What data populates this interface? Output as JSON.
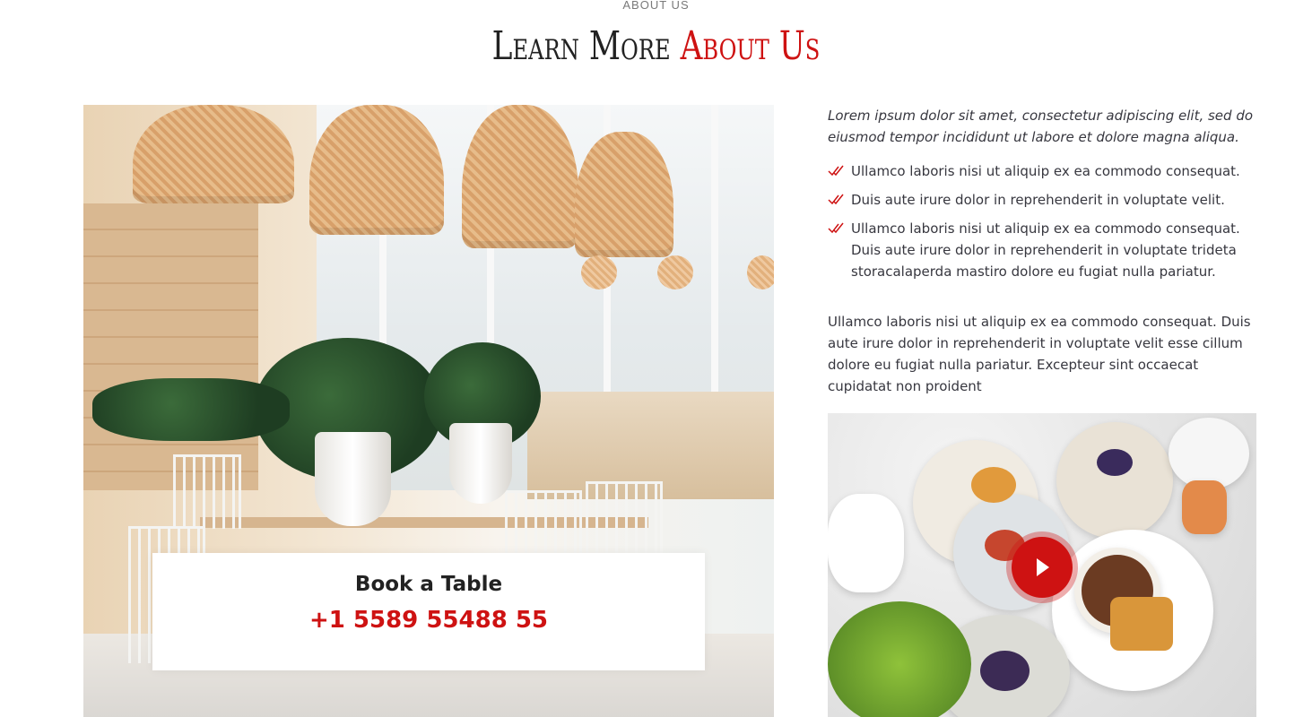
{
  "header": {
    "eyebrow": "ABOUT US",
    "title_main": "Learn More ",
    "title_accent": "About Us"
  },
  "booking": {
    "title": "Book a Table",
    "phone": "+1 5589 55488 55"
  },
  "content": {
    "intro": "Lorem ipsum dolor sit amet, consectetur adipiscing elit, sed do eiusmod tempor incididunt ut labore et dolore magna aliqua.",
    "checklist": [
      "Ullamco laboris nisi ut aliquip ex ea commodo consequat.",
      "Duis aute irure dolor in reprehenderit in voluptate velit.",
      "Ullamco laboris nisi ut aliquip ex ea commodo consequat. Duis aute irure dolor in reprehenderit in voluptate trideta storacalaperda mastiro dolore eu fugiat nulla pariatur."
    ],
    "body": "Ullamco laboris nisi ut aliquip ex ea commodo consequat. Duis aute irure dolor in reprehenderit in voluptate velit esse cillum dolore eu fugiat nulla pariatur. Excepteur sint occaecat cupidatat non proident"
  },
  "icons": {
    "check": "double-check-icon",
    "play": "play-icon"
  },
  "colors": {
    "accent": "#ce1212",
    "text": "#37373f",
    "heading": "#222222"
  }
}
